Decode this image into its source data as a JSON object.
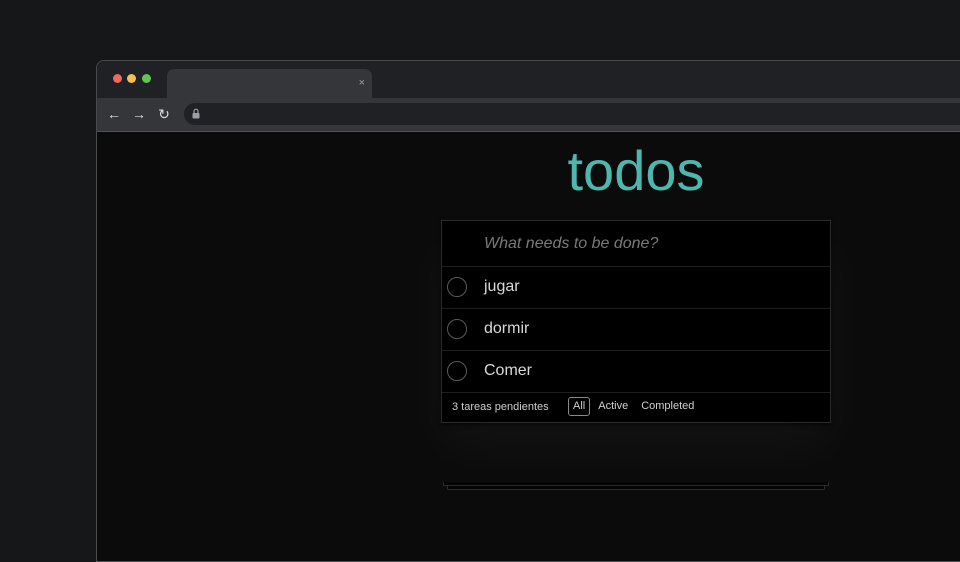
{
  "browser": {
    "tab_close": "×",
    "nav": {
      "back": "←",
      "forward": "→",
      "reload": "↻"
    }
  },
  "app": {
    "title": "todos",
    "new_todo_placeholder": "What needs to be done?",
    "items": [
      {
        "label": "jugar",
        "completed": false
      },
      {
        "label": "dormir",
        "completed": false
      },
      {
        "label": "Comer",
        "completed": false
      }
    ],
    "footer": {
      "count_text": "3 tareas pendientes",
      "filters": [
        {
          "label": "All",
          "selected": true
        },
        {
          "label": "Active",
          "selected": false
        },
        {
          "label": "Completed",
          "selected": false
        }
      ]
    }
  },
  "colors": {
    "accent": "#4fb6ad",
    "background": "#0b0b0b",
    "traffic_red": "#ed6a5e",
    "traffic_yellow": "#f5bf4f",
    "traffic_green": "#61c554"
  }
}
